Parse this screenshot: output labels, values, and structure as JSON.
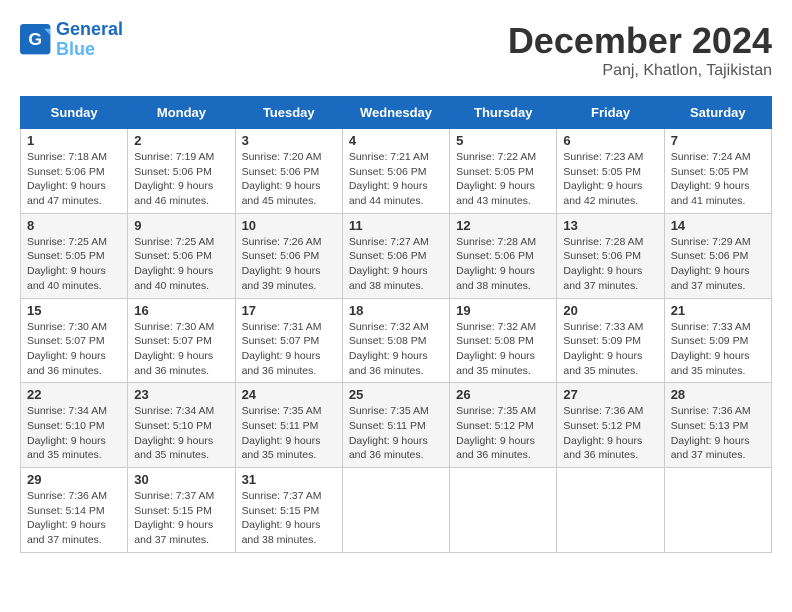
{
  "logo": {
    "line1": "General",
    "line2": "Blue"
  },
  "title": "December 2024",
  "subtitle": "Panj, Khatlon, Tajikistan",
  "days_of_week": [
    "Sunday",
    "Monday",
    "Tuesday",
    "Wednesday",
    "Thursday",
    "Friday",
    "Saturday"
  ],
  "weeks": [
    [
      {
        "day": 1,
        "info": "Sunrise: 7:18 AM\nSunset: 5:06 PM\nDaylight: 9 hours\nand 47 minutes."
      },
      {
        "day": 2,
        "info": "Sunrise: 7:19 AM\nSunset: 5:06 PM\nDaylight: 9 hours\nand 46 minutes."
      },
      {
        "day": 3,
        "info": "Sunrise: 7:20 AM\nSunset: 5:06 PM\nDaylight: 9 hours\nand 45 minutes."
      },
      {
        "day": 4,
        "info": "Sunrise: 7:21 AM\nSunset: 5:06 PM\nDaylight: 9 hours\nand 44 minutes."
      },
      {
        "day": 5,
        "info": "Sunrise: 7:22 AM\nSunset: 5:05 PM\nDaylight: 9 hours\nand 43 minutes."
      },
      {
        "day": 6,
        "info": "Sunrise: 7:23 AM\nSunset: 5:05 PM\nDaylight: 9 hours\nand 42 minutes."
      },
      {
        "day": 7,
        "info": "Sunrise: 7:24 AM\nSunset: 5:05 PM\nDaylight: 9 hours\nand 41 minutes."
      }
    ],
    [
      {
        "day": 8,
        "info": "Sunrise: 7:25 AM\nSunset: 5:05 PM\nDaylight: 9 hours\nand 40 minutes."
      },
      {
        "day": 9,
        "info": "Sunrise: 7:25 AM\nSunset: 5:06 PM\nDaylight: 9 hours\nand 40 minutes."
      },
      {
        "day": 10,
        "info": "Sunrise: 7:26 AM\nSunset: 5:06 PM\nDaylight: 9 hours\nand 39 minutes."
      },
      {
        "day": 11,
        "info": "Sunrise: 7:27 AM\nSunset: 5:06 PM\nDaylight: 9 hours\nand 38 minutes."
      },
      {
        "day": 12,
        "info": "Sunrise: 7:28 AM\nSunset: 5:06 PM\nDaylight: 9 hours\nand 38 minutes."
      },
      {
        "day": 13,
        "info": "Sunrise: 7:28 AM\nSunset: 5:06 PM\nDaylight: 9 hours\nand 37 minutes."
      },
      {
        "day": 14,
        "info": "Sunrise: 7:29 AM\nSunset: 5:06 PM\nDaylight: 9 hours\nand 37 minutes."
      }
    ],
    [
      {
        "day": 15,
        "info": "Sunrise: 7:30 AM\nSunset: 5:07 PM\nDaylight: 9 hours\nand 36 minutes."
      },
      {
        "day": 16,
        "info": "Sunrise: 7:30 AM\nSunset: 5:07 PM\nDaylight: 9 hours\nand 36 minutes."
      },
      {
        "day": 17,
        "info": "Sunrise: 7:31 AM\nSunset: 5:07 PM\nDaylight: 9 hours\nand 36 minutes."
      },
      {
        "day": 18,
        "info": "Sunrise: 7:32 AM\nSunset: 5:08 PM\nDaylight: 9 hours\nand 36 minutes."
      },
      {
        "day": 19,
        "info": "Sunrise: 7:32 AM\nSunset: 5:08 PM\nDaylight: 9 hours\nand 35 minutes."
      },
      {
        "day": 20,
        "info": "Sunrise: 7:33 AM\nSunset: 5:09 PM\nDaylight: 9 hours\nand 35 minutes."
      },
      {
        "day": 21,
        "info": "Sunrise: 7:33 AM\nSunset: 5:09 PM\nDaylight: 9 hours\nand 35 minutes."
      }
    ],
    [
      {
        "day": 22,
        "info": "Sunrise: 7:34 AM\nSunset: 5:10 PM\nDaylight: 9 hours\nand 35 minutes."
      },
      {
        "day": 23,
        "info": "Sunrise: 7:34 AM\nSunset: 5:10 PM\nDaylight: 9 hours\nand 35 minutes."
      },
      {
        "day": 24,
        "info": "Sunrise: 7:35 AM\nSunset: 5:11 PM\nDaylight: 9 hours\nand 35 minutes."
      },
      {
        "day": 25,
        "info": "Sunrise: 7:35 AM\nSunset: 5:11 PM\nDaylight: 9 hours\nand 36 minutes."
      },
      {
        "day": 26,
        "info": "Sunrise: 7:35 AM\nSunset: 5:12 PM\nDaylight: 9 hours\nand 36 minutes."
      },
      {
        "day": 27,
        "info": "Sunrise: 7:36 AM\nSunset: 5:12 PM\nDaylight: 9 hours\nand 36 minutes."
      },
      {
        "day": 28,
        "info": "Sunrise: 7:36 AM\nSunset: 5:13 PM\nDaylight: 9 hours\nand 37 minutes."
      }
    ],
    [
      {
        "day": 29,
        "info": "Sunrise: 7:36 AM\nSunset: 5:14 PM\nDaylight: 9 hours\nand 37 minutes."
      },
      {
        "day": 30,
        "info": "Sunrise: 7:37 AM\nSunset: 5:15 PM\nDaylight: 9 hours\nand 37 minutes."
      },
      {
        "day": 31,
        "info": "Sunrise: 7:37 AM\nSunset: 5:15 PM\nDaylight: 9 hours\nand 38 minutes."
      },
      null,
      null,
      null,
      null
    ]
  ]
}
